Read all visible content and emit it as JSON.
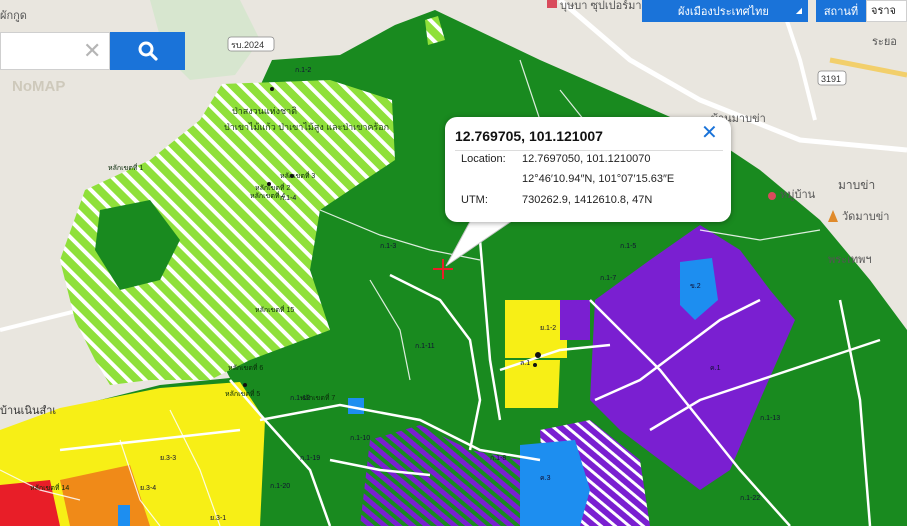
{
  "map": {
    "labels": {
      "top_left_place": "ผักกูด",
      "top_poi": "บุษบา ซุปเปอร์มาร์",
      "road_rb2024": "รบ.2024",
      "road_3191": "3191",
      "watermark": "NoMAP",
      "east_right": "ระยอ",
      "village_mabkha": "บ้านมาบข่า",
      "muban": "หมู่บ้าน",
      "mabkha": "มาบข่า",
      "wat_mabkha": "วัดมาบข่า",
      "phra_thep": "พระเทพฯ",
      "left_place": "บ้านเนินสำเ",
      "forest_line1": "ป่าสงวนแห่งชาติ",
      "forest_line2": "ป่าเขาไม้แก้ว ป่าเขาไม้สูง และป่าเขาคร้อก"
    },
    "zone_codes": [
      "ก.1-2",
      "ก.1-3",
      "ก.1-4",
      "ก.1-5",
      "ก.1-7",
      "ก.1-8",
      "ก.1-10",
      "ก.1-11",
      "ก.1-12",
      "ก.1-13",
      "ก.1-19",
      "ก.1-20",
      "ก.1-22",
      "ก.1-23",
      "ย.3-1",
      "ย.3-3",
      "ย.3-4",
      "ย.1-2",
      "ล.1",
      "ค.1",
      "ค.3",
      "ข.2"
    ],
    "point_labels": [
      "หลักเขตที่ 1",
      "หลักเขตที่ 2",
      "หลักเขตที่ 3",
      "หลักเขตที่ 4",
      "หลักเขตที่ 5",
      "หลักเขตที่ 6",
      "หลักเขตที่ 7",
      "หลักเขตที่ 14",
      "หลักเขตที่ 15"
    ],
    "marker_icon": "red-cross-marker-icon"
  },
  "search": {
    "placeholder": "",
    "clear_icon": "close-icon",
    "button_icon": "search-icon"
  },
  "topbar": {
    "layer_select": "ผังเมืองประเทศไทย",
    "station_label": "สถานที่",
    "station_value": "จราจ"
  },
  "popup": {
    "title": "12.769705, 101.121007",
    "location_label": "Location:",
    "location_decimal": "12.7697050, 101.1210070",
    "location_dms": "12°46′10.94″N, 101°07′15.63″E",
    "utm_label": "UTM:",
    "utm_value": "730262.9, 1412610.8, 47N"
  },
  "colors": {
    "forest_green": "#198a1f",
    "light_green": "#8fe03a",
    "yellow": "#f7ef16",
    "purple": "#7a1fd1",
    "blue": "#1d8ef0",
    "orange": "#f08a18",
    "red": "#e81e28",
    "accent_blue": "#1a73d9",
    "base": "#e9e6df"
  }
}
